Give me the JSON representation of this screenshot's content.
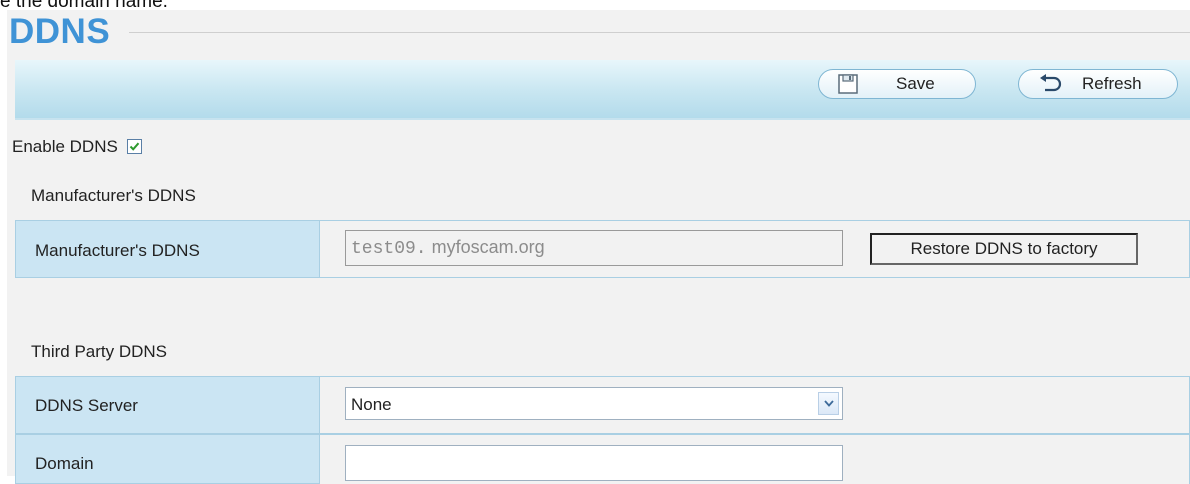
{
  "doc_fragment": "e the domain name.",
  "page": {
    "title": "DDNS"
  },
  "toolbar": {
    "save_label": "Save",
    "refresh_label": "Refresh"
  },
  "enable_ddns": {
    "label": "Enable DDNS",
    "checked": true
  },
  "manufacturer_section": {
    "heading": "Manufacturer's DDNS",
    "row_label": "Manufacturer's DDNS",
    "value_prefix": "test09.",
    "value_domain": "myfoscam.org",
    "restore_button_label": "Restore DDNS to factory"
  },
  "third_party_section": {
    "heading": "Third Party DDNS",
    "server_label": "DDNS Server",
    "server_value": "None",
    "domain_label": "Domain",
    "domain_value": ""
  },
  "colors": {
    "title": "#3f93d6",
    "label_cell_bg": "#cbe5f3",
    "toolbar_bg": "#c8e6f1",
    "panel_bg": "#f2f2f2"
  },
  "icons": {
    "save": "floppy-disk-icon",
    "refresh": "refresh-arrow-icon",
    "dropdown": "chevron-down-icon"
  }
}
